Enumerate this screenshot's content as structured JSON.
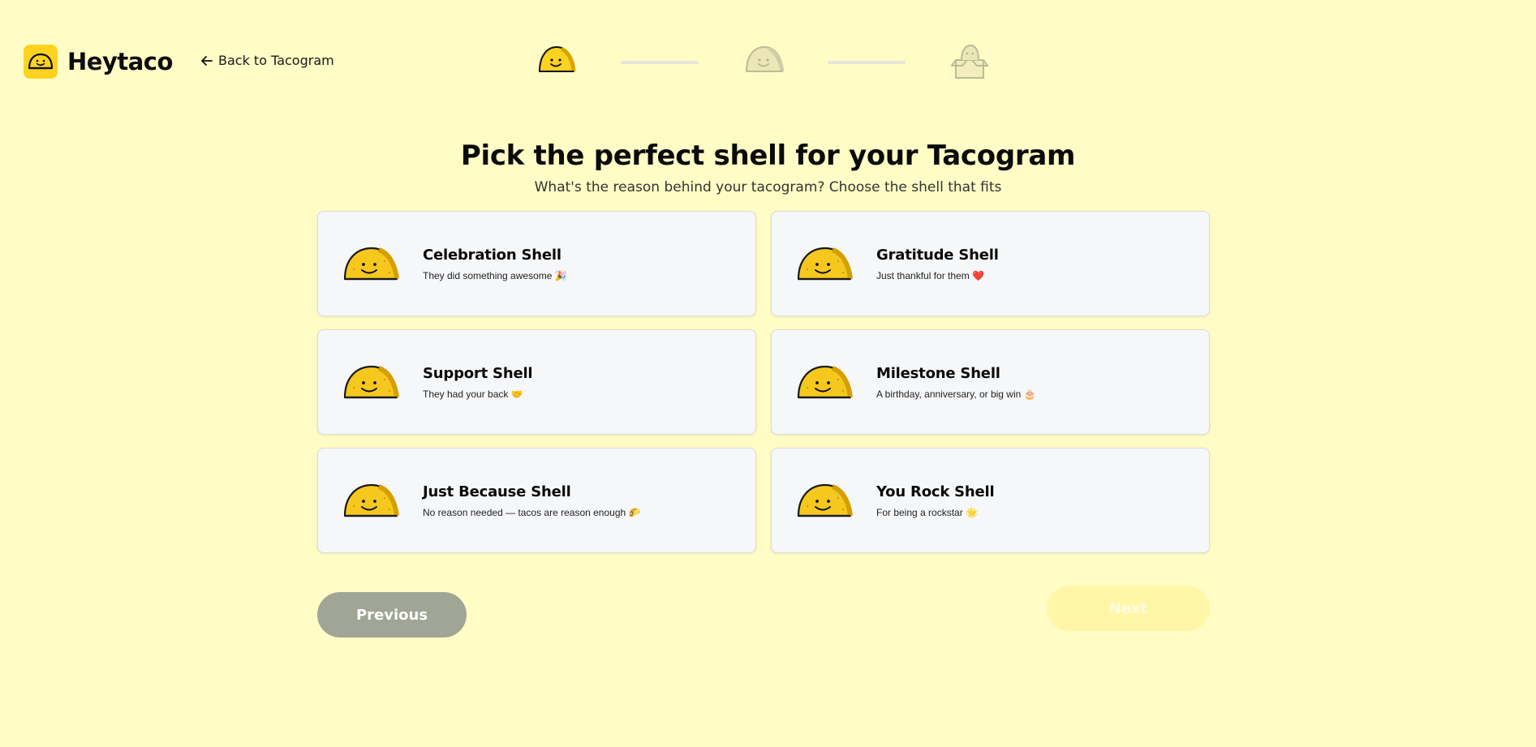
{
  "header": {
    "brand": "Heytaco",
    "back_link": "Back to Tacogram"
  },
  "stepper": {
    "steps": [
      {
        "name": "shell",
        "state": "active",
        "icon": "taco-icon"
      },
      {
        "name": "filling",
        "state": "inactive",
        "icon": "taco-filled-icon"
      },
      {
        "name": "delivery",
        "state": "inactive",
        "icon": "box-icon"
      }
    ]
  },
  "main": {
    "title": "Pick the perfect shell for your Tacogram",
    "subtitle": "What's the reason behind your tacogram? Choose the shell that fits",
    "shells": [
      {
        "title": "Celebration Shell",
        "description": "They did something awesome 🎉"
      },
      {
        "title": "Gratitude Shell",
        "description": "Just thankful for them ❤️"
      },
      {
        "title": "Support Shell",
        "description": "They had your back 🤝"
      },
      {
        "title": "Milestone Shell",
        "description": "A birthday, anniversary, or big win 🎂"
      },
      {
        "title": "Just Because Shell",
        "description": "No reason needed — tacos are reason enough 🌮"
      },
      {
        "title": "You Rock Shell",
        "description": "For being a rockstar 🌟"
      }
    ]
  },
  "buttons": {
    "previous": "Previous",
    "next": "Next"
  },
  "colors": {
    "background": "#fffcc5",
    "brand_yellow": "#fcd321",
    "previous_button": "#a0a596",
    "next_button_disabled": "#fff6a8"
  }
}
